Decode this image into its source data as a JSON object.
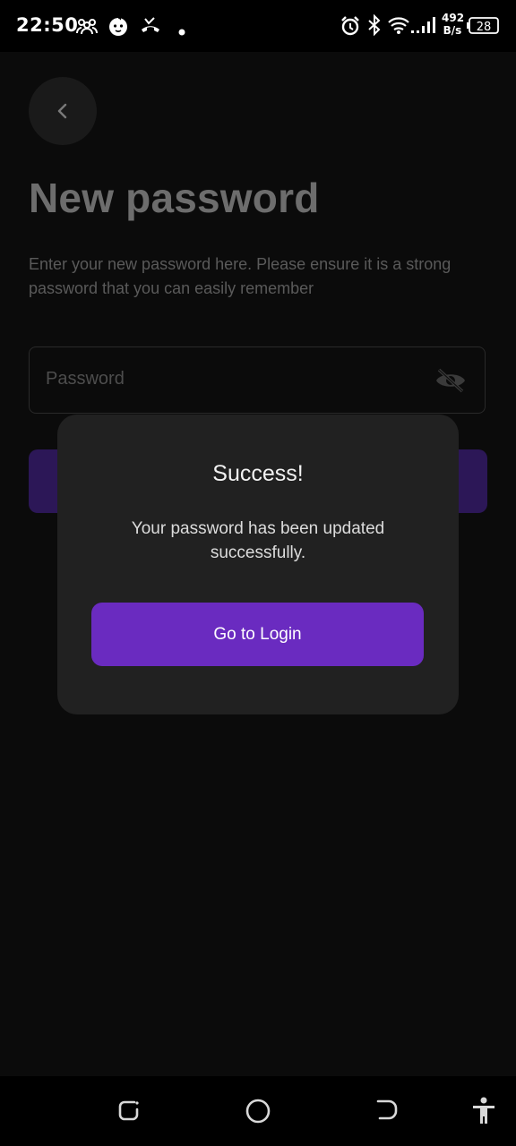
{
  "status_bar": {
    "time": "22:50",
    "net_speed_value": "492",
    "net_speed_unit": "B/s",
    "battery": "28",
    "icons": [
      "group-icon",
      "baby-face-icon",
      "missed-call-icon",
      "dot-icon",
      "alarm-icon",
      "bluetooth-icon",
      "wifi-icon",
      "signal-icon",
      "battery-icon"
    ]
  },
  "page": {
    "title": "New password",
    "subtitle": "Enter your new password here. Please ensure it is a strong password that you can easily remember",
    "password_placeholder": "Password"
  },
  "modal": {
    "title": "Success!",
    "message": "Your password has been updated successfully.",
    "button_label": "Go to Login"
  },
  "colors": {
    "accent": "#6a2bc0",
    "modal_bg": "#212121",
    "screen_bg": "#0b0b0b"
  },
  "nav_bar": {
    "icons": [
      "recents-icon",
      "home-icon",
      "back-icon",
      "accessibility-icon"
    ]
  }
}
